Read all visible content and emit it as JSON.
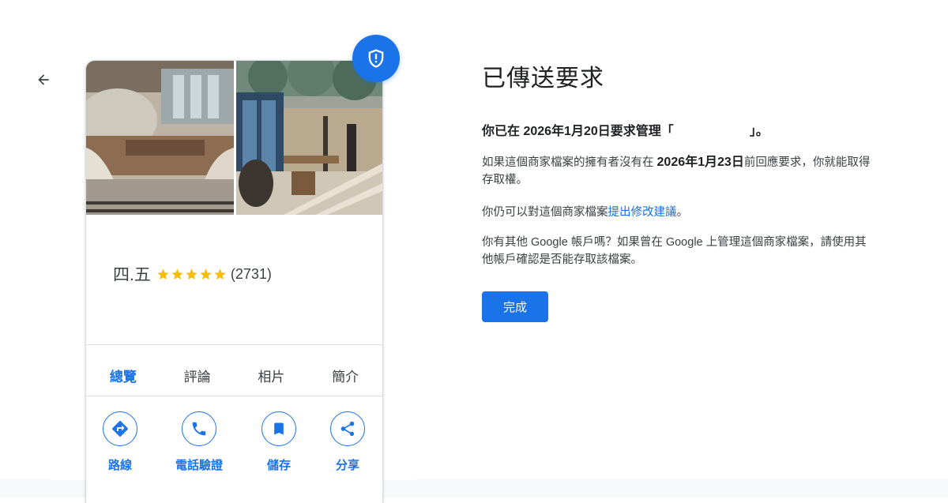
{
  "profile_card": {
    "business_name": "四.五",
    "rating": 5,
    "review_count": "(2731)",
    "tabs": [
      {
        "label": "總覽",
        "active": true
      },
      {
        "label": "評論",
        "active": false
      },
      {
        "label": "相片",
        "active": false
      },
      {
        "label": "簡介",
        "active": false
      }
    ],
    "actions": [
      {
        "label": "路線",
        "icon": "directions-icon"
      },
      {
        "label": "電話驗證",
        "icon": "phone-icon"
      },
      {
        "label": "儲存",
        "icon": "bookmark-icon"
      },
      {
        "label": "分享",
        "icon": "share-icon"
      }
    ]
  },
  "request": {
    "heading": "已傳送要求",
    "lead_prefix": "你已在 2026年1月20日要求管理「",
    "lead_suffix": "」。",
    "para1_prefix": "如果這個商家檔案的擁有者沒有在 ",
    "para1_date": "2026年1月23日",
    "para1_suffix": "前回應要求，你就能取得存取權。",
    "para2_prefix": "你仍可以對這個商家檔案",
    "para2_link": "提出修改建議",
    "para2_suffix": "。",
    "para3": "你有其他 Google 帳戶嗎？如果曾在 Google 上管理這個商家檔案，請使用其他帳戶確認是否能存取該檔案。",
    "done_label": "完成"
  },
  "colors": {
    "accent": "#1a73e8",
    "star": "#fbbc04",
    "text": "#202124"
  }
}
